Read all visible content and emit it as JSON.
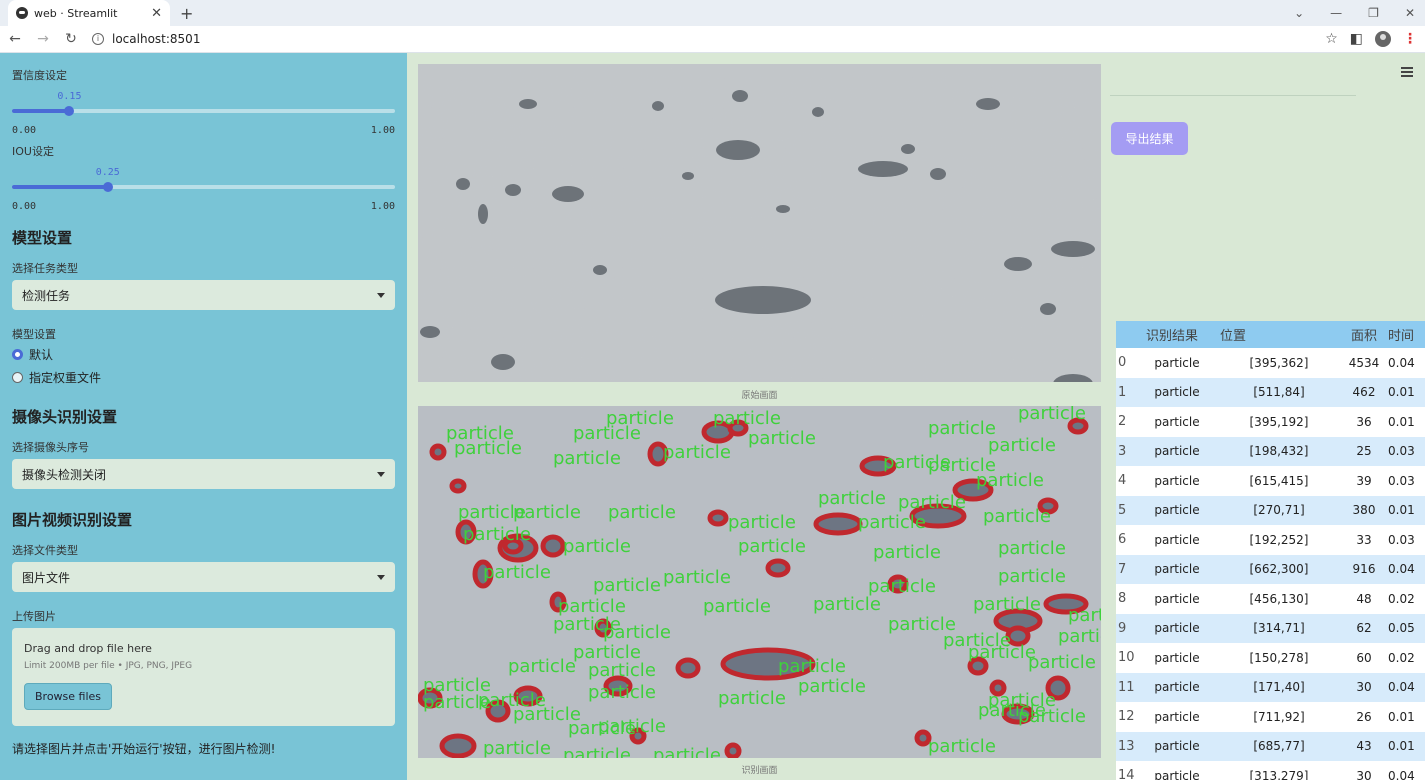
{
  "browser": {
    "tab_title": "web · Streamlit",
    "url": "localhost:8501"
  },
  "sidebar": {
    "conf_label": "置信度设定",
    "conf_value": "0.15",
    "conf_fraction": 0.15,
    "conf_min": "0.00",
    "conf_max": "1.00",
    "iou_label": "IOU设定",
    "iou_value": "0.25",
    "iou_fraction": 0.25,
    "iou_min": "0.00",
    "iou_max": "1.00",
    "model_header": "模型设置",
    "task_label": "选择任务类型",
    "task_value": "检测任务",
    "model_label": "模型设置",
    "model_options": [
      "默认",
      "指定权重文件"
    ],
    "camera_header": "摄像头识别设置",
    "camera_label": "选择摄像头序号",
    "camera_value": "摄像头检测关闭",
    "media_header": "图片视频识别设置",
    "filetype_label": "选择文件类型",
    "filetype_value": "图片文件",
    "upload_label": "上传图片",
    "upload_drag": "Drag and drop file here",
    "upload_limit": "Limit 200MB per file • JPG, PNG, JPEG",
    "upload_button": "Browse files",
    "hint": "请选择图片并点击'开始运行'按钮，进行图片检测!"
  },
  "main": {
    "caption_original": "原始画面",
    "caption_detect": "识别画面",
    "export_button": "导出结果",
    "detect_label": "particle"
  },
  "table": {
    "headers": [
      "",
      "识别结果",
      "位置",
      "面积",
      "时间"
    ],
    "rows": [
      [
        "0",
        "particle",
        "[395,362]",
        "4534",
        "0.04"
      ],
      [
        "1",
        "particle",
        "[511,84]",
        "462",
        "0.01"
      ],
      [
        "2",
        "particle",
        "[395,192]",
        "36",
        "0.01"
      ],
      [
        "3",
        "particle",
        "[198,432]",
        "25",
        "0.03"
      ],
      [
        "4",
        "particle",
        "[615,415]",
        "39",
        "0.03"
      ],
      [
        "5",
        "particle",
        "[270,71]",
        "380",
        "0.01"
      ],
      [
        "6",
        "particle",
        "[192,252]",
        "33",
        "0.03"
      ],
      [
        "7",
        "particle",
        "[662,300]",
        "916",
        "0.04"
      ],
      [
        "8",
        "particle",
        "[456,130]",
        "48",
        "0.02"
      ],
      [
        "9",
        "particle",
        "[314,71]",
        "62",
        "0.05"
      ],
      [
        "10",
        "particle",
        "[150,278]",
        "60",
        "0.02"
      ],
      [
        "11",
        "particle",
        "[171,40]",
        "30",
        "0.04"
      ],
      [
        "12",
        "particle",
        "[711,92]",
        "26",
        "0.01"
      ],
      [
        "13",
        "particle",
        "[685,77]",
        "43",
        "0.01"
      ],
      [
        "14",
        "particle",
        "[313,279]",
        "30",
        "0.04"
      ]
    ]
  },
  "colors": {
    "sidebar_bg": "#79c4d6",
    "main_bg": "#d9e8d5",
    "accent": "#4a6bd6",
    "export_bg": "#a49cf3",
    "detect_outline": "#c0282e",
    "detect_text": "#3fd13c"
  }
}
